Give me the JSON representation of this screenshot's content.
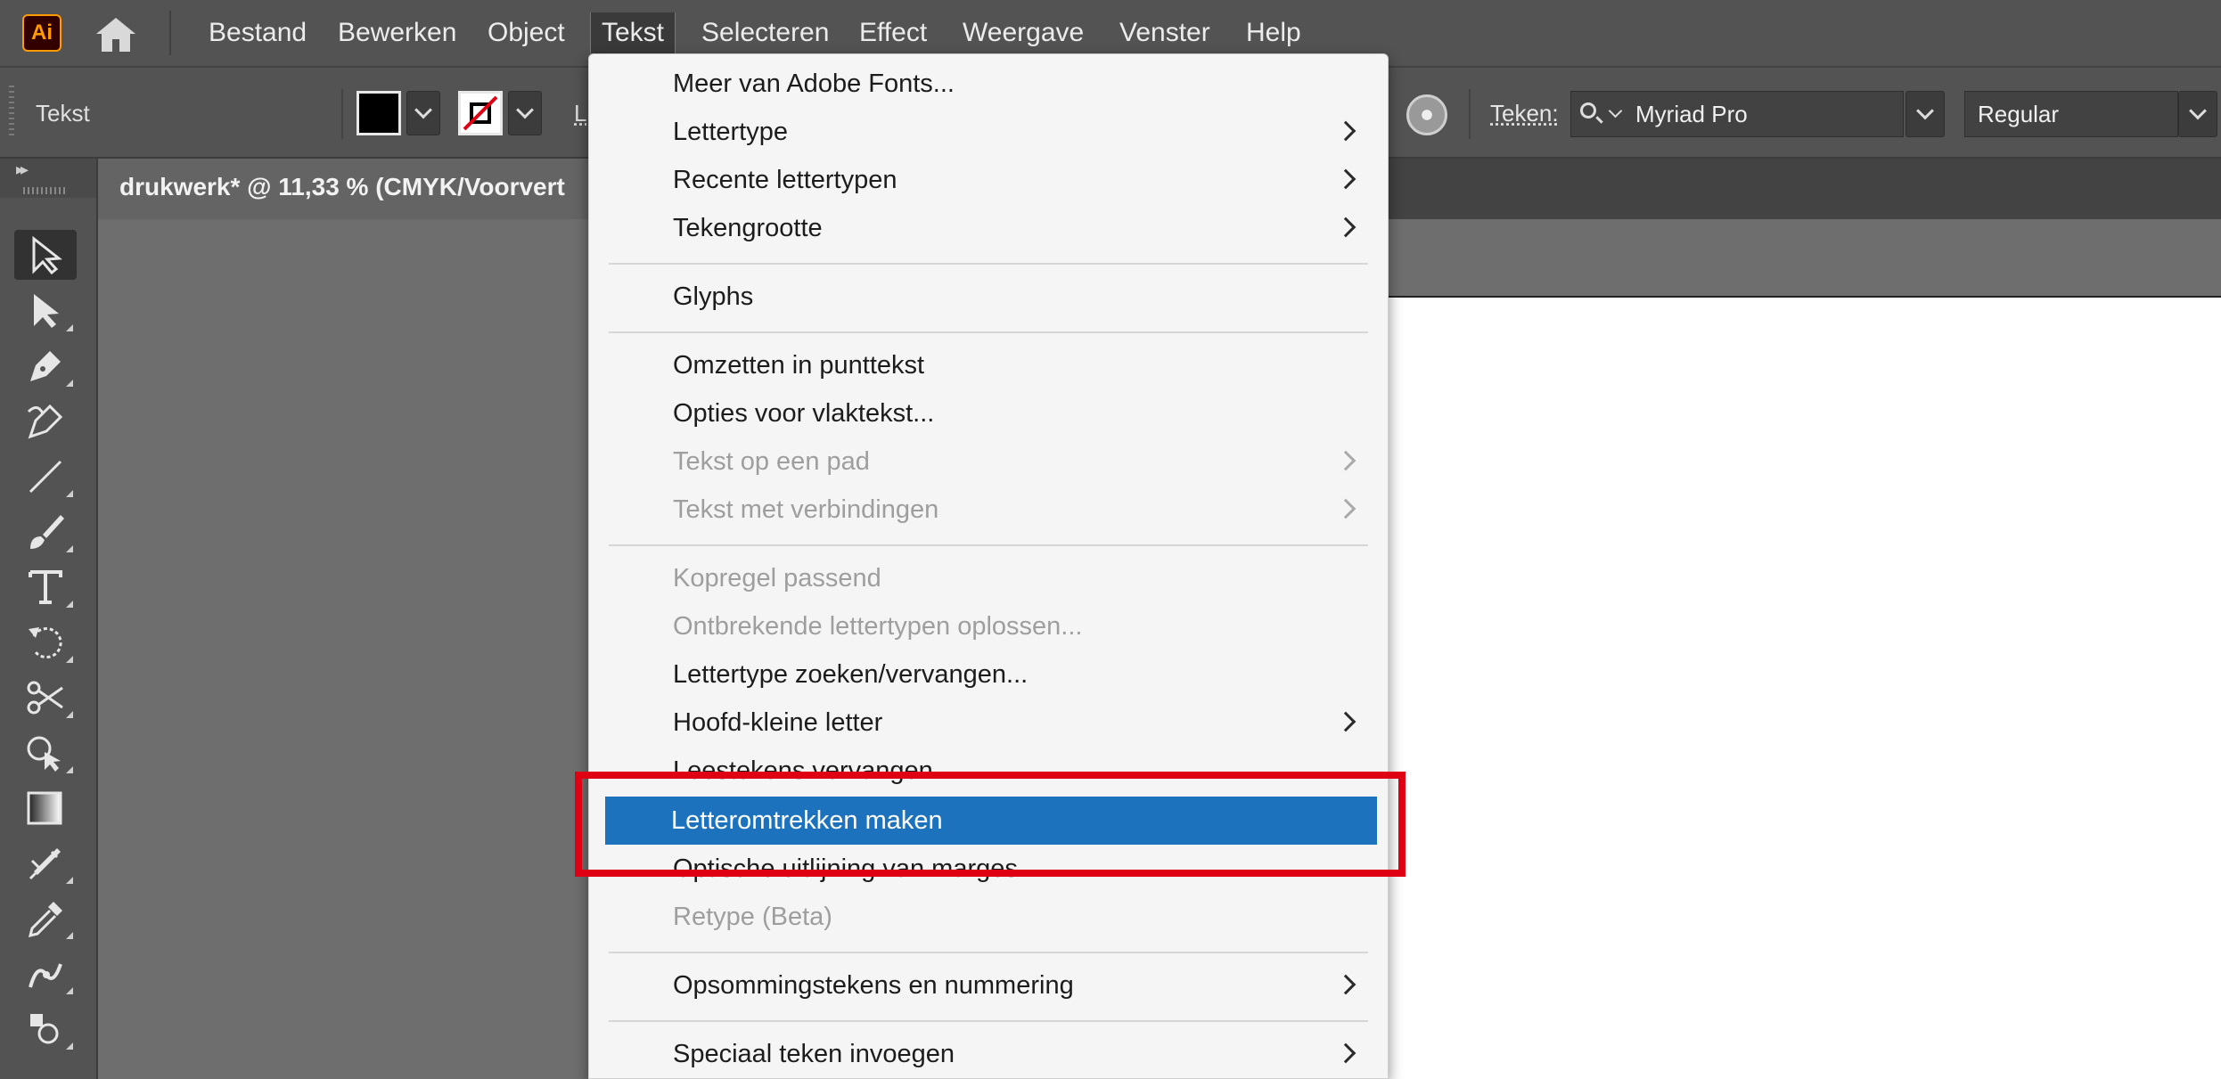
{
  "app": {
    "logo": "Ai"
  },
  "menubar": {
    "items": [
      {
        "label": "Bestand"
      },
      {
        "label": "Bewerken"
      },
      {
        "label": "Object"
      },
      {
        "label": "Tekst",
        "active": true
      },
      {
        "label": "Selecteren"
      },
      {
        "label": "Effect"
      },
      {
        "label": "Weergave"
      },
      {
        "label": "Venster"
      },
      {
        "label": "Help"
      }
    ]
  },
  "controlbar": {
    "context_label": "Tekst",
    "fill_color": "#000000",
    "stroke_color": "none",
    "stroke_partial_label": "L",
    "character_label": "Teken:",
    "font_family": "Myriad Pro",
    "font_style": "Regular"
  },
  "document": {
    "tab_title": "drukwerk* @ 11,33 % (CMYK/Voorvert"
  },
  "tools": [
    {
      "name": "selection-tool",
      "icon": "arrow-icon",
      "selected": true
    },
    {
      "name": "direct-selection-tool",
      "icon": "white-arrow-icon"
    },
    {
      "name": "pen-tool",
      "icon": "pen-icon"
    },
    {
      "name": "curvature-tool",
      "icon": "curvature-pen-icon"
    },
    {
      "name": "line-tool",
      "icon": "line-icon"
    },
    {
      "name": "paintbrush-tool",
      "icon": "brush-icon"
    },
    {
      "name": "type-tool",
      "icon": "type-icon"
    },
    {
      "name": "rotate-tool",
      "icon": "rotate-icon"
    },
    {
      "name": "scissors-tool",
      "icon": "scissors-icon"
    },
    {
      "name": "shape-builder-tool",
      "icon": "shape-builder-icon"
    },
    {
      "name": "gradient-tool",
      "icon": "gradient-icon"
    },
    {
      "name": "mesh-tool",
      "icon": "mesh-icon"
    },
    {
      "name": "eyedropper-tool",
      "icon": "eyedropper-icon"
    },
    {
      "name": "puppet-warp-tool",
      "icon": "puppet-warp-icon"
    },
    {
      "name": "symbol-sprayer-tool",
      "icon": "symbol-sprayer-icon"
    }
  ],
  "text_menu": {
    "items": [
      {
        "label": "Meer van Adobe Fonts...",
        "submenu": false,
        "disabled": false
      },
      {
        "label": "Lettertype",
        "submenu": true,
        "disabled": false
      },
      {
        "label": "Recente lettertypen",
        "submenu": true,
        "disabled": false
      },
      {
        "label": "Tekengrootte",
        "submenu": true,
        "disabled": false
      },
      {
        "label": "Glyphs",
        "submenu": false,
        "disabled": false
      },
      {
        "label": "Omzetten in punttekst",
        "submenu": false,
        "disabled": false
      },
      {
        "label": "Opties voor vlaktekst...",
        "submenu": false,
        "disabled": false
      },
      {
        "label": "Tekst op een pad",
        "submenu": true,
        "disabled": true
      },
      {
        "label": "Tekst met verbindingen",
        "submenu": true,
        "disabled": true
      },
      {
        "label": "Kopregel passend",
        "submenu": false,
        "disabled": true
      },
      {
        "label": "Ontbrekende lettertypen oplossen...",
        "submenu": false,
        "disabled": true
      },
      {
        "label": "Lettertype zoeken/vervangen...",
        "submenu": false,
        "disabled": false
      },
      {
        "label": "Hoofd-kleine letter",
        "submenu": true,
        "disabled": false
      },
      {
        "label": "Leestekens vervangen...",
        "submenu": false,
        "disabled": false
      },
      {
        "label": "Letteromtrekken maken",
        "submenu": false,
        "disabled": false,
        "highlighted": true
      },
      {
        "label": "Optische uitlijning van marges",
        "submenu": false,
        "disabled": false
      },
      {
        "label": "Retype (Beta)",
        "submenu": false,
        "disabled": true
      },
      {
        "label": "Opsommingstekens en nummering",
        "submenu": true,
        "disabled": false
      },
      {
        "label": "Speciaal teken invoegen",
        "submenu": true,
        "disabled": false
      }
    ]
  },
  "colors": {
    "highlight": "#1d72be",
    "annotation_frame": "#e00014",
    "brand_orange": "#ff9a00"
  }
}
